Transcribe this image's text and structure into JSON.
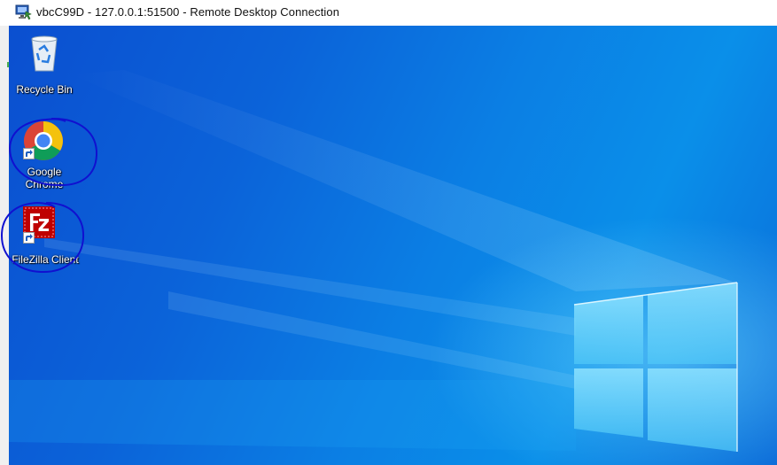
{
  "window": {
    "title": "vbcC99D - 127.0.0.1:51500 - Remote Desktop Connection"
  },
  "desktop": {
    "icons": [
      {
        "label": "Recycle Bin",
        "icon": "recycle-bin-icon"
      },
      {
        "label_line1": "Google",
        "label_line2": "Chrome",
        "icon": "chrome-icon",
        "shortcut": true
      },
      {
        "label": "FileZilla Client",
        "icon": "filezilla-icon",
        "shortcut": true
      }
    ],
    "wallpaper": "windows-10-hero",
    "annotation_color": "#1010d0"
  },
  "colors": {
    "desktop_dark": "#0b4fd0",
    "desktop_light": "#0a8fe9",
    "filezilla_red": "#bf0000"
  }
}
